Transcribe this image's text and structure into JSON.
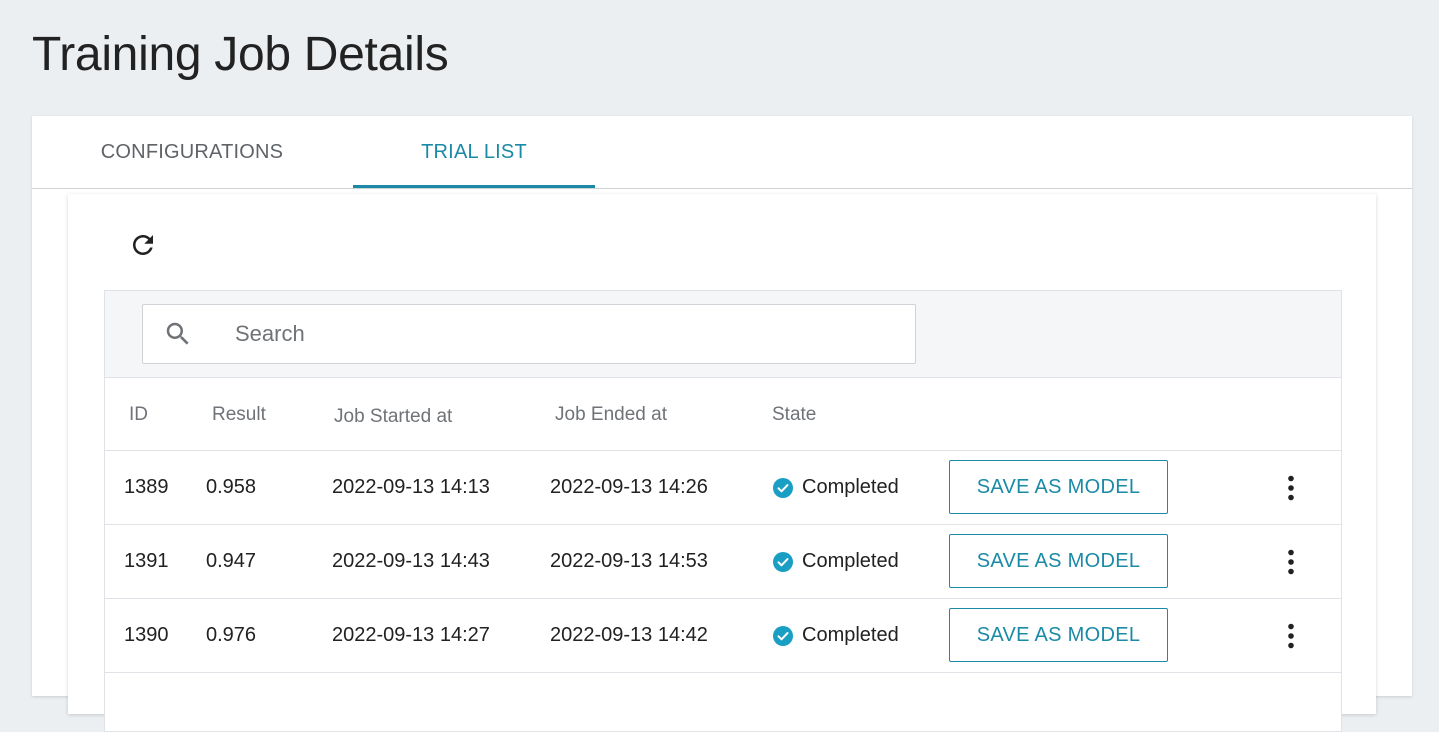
{
  "page": {
    "title": "Training Job Details"
  },
  "tabs": [
    {
      "label": "CONFIGURATIONS",
      "active": false
    },
    {
      "label": "TRIAL LIST",
      "active": true
    }
  ],
  "toolbar": {
    "refresh_icon": "refresh-icon"
  },
  "search": {
    "placeholder": "Search",
    "value": "",
    "icon": "search-icon"
  },
  "table": {
    "columns": [
      "ID",
      "Result",
      "Job Started at",
      "Job Ended at",
      "State"
    ],
    "rows": [
      {
        "id": "1389",
        "result": "0.958",
        "started": "2022-09-13 14:13",
        "ended": "2022-09-13 14:26",
        "state": "Completed",
        "action": "SAVE AS MODEL"
      },
      {
        "id": "1391",
        "result": "0.947",
        "started": "2022-09-13 14:43",
        "ended": "2022-09-13 14:53",
        "state": "Completed",
        "action": "SAVE AS MODEL"
      },
      {
        "id": "1390",
        "result": "0.976",
        "started": "2022-09-13 14:27",
        "ended": "2022-09-13 14:42",
        "state": "Completed",
        "action": "SAVE AS MODEL"
      }
    ]
  },
  "colors": {
    "accent": "#1a8aa6",
    "state_completed": "#1a9fc4",
    "background": "#eceff2"
  }
}
